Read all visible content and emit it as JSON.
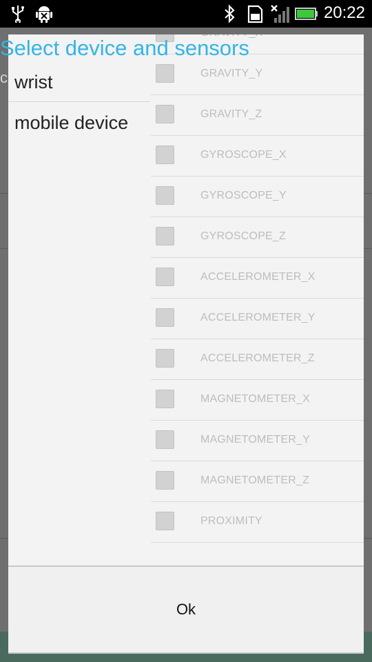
{
  "status_bar": {
    "time": "20:22",
    "icons": [
      "usb-icon",
      "android-debug-icon",
      "bluetooth-icon",
      "sd-card-icon",
      "no-signal-icon",
      "battery-icon"
    ]
  },
  "background_app": {
    "fragment_text": "c"
  },
  "dialog": {
    "title": "Select device and sensors",
    "devices": [
      "wrist",
      "mobile device"
    ],
    "sensors": [
      "GRAVITY_X",
      "GRAVITY_Y",
      "GRAVITY_Z",
      "GYROSCOPE_X",
      "GYROSCOPE_Y",
      "GYROSCOPE_Z",
      "ACCELEROMETER_X",
      "ACCELEROMETER_Y",
      "ACCELEROMETER_Z",
      "MAGNETOMETER_X",
      "MAGNETOMETER_Y",
      "MAGNETOMETER_Z",
      "PROXIMITY"
    ],
    "ok_label": "Ok"
  },
  "colors": {
    "title": "#33b5e5",
    "battery": "#3cc83c"
  }
}
